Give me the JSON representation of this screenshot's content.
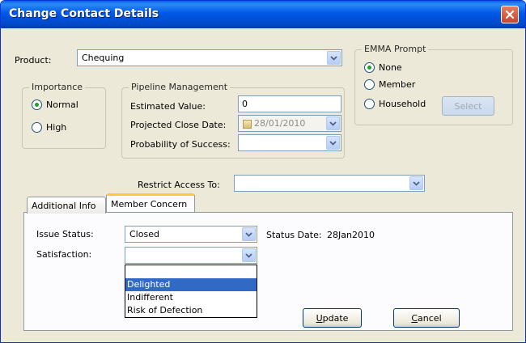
{
  "window": {
    "title": "Change Contact Details"
  },
  "product": {
    "label": "Product:",
    "value": "Chequing"
  },
  "emma": {
    "legend": "EMMA Prompt",
    "options": [
      "None",
      "Member",
      "Household"
    ],
    "selected": "None",
    "select_button": "Select"
  },
  "importance": {
    "legend": "Importance",
    "options": [
      "Normal",
      "High"
    ],
    "selected": "Normal"
  },
  "pipeline": {
    "legend": "Pipeline Management",
    "estimated_value_label": "Estimated Value:",
    "estimated_value": "0",
    "close_date_label": "Projected Close Date:",
    "close_date": "28/01/2010",
    "probability_label": "Probability of Success:",
    "probability_value": ""
  },
  "restrict": {
    "label": "Restrict Access To:",
    "value": ""
  },
  "tabs": {
    "additional": "Additional Info",
    "concern": "Member Concern",
    "active": "Member Concern"
  },
  "concern": {
    "issue_label": "Issue Status:",
    "issue_value": "Closed",
    "status_date_label": "Status Date:",
    "status_date": "28Jan2010",
    "satisfaction_label": "Satisfaction:",
    "satisfaction_value": "",
    "satisfaction_options": [
      "",
      "Delighted",
      "Indifferent",
      "Risk of Defection"
    ],
    "highlighted": "Delighted"
  },
  "buttons": {
    "update_prefix": "U",
    "update_rest": "pdate",
    "cancel_prefix": "C",
    "cancel_rest": "ancel"
  },
  "colors": {
    "titlebar": "#0058e6",
    "accent_tab": "#ffc83c",
    "selection": "#316ac5",
    "radio_dot": "#21a121"
  }
}
